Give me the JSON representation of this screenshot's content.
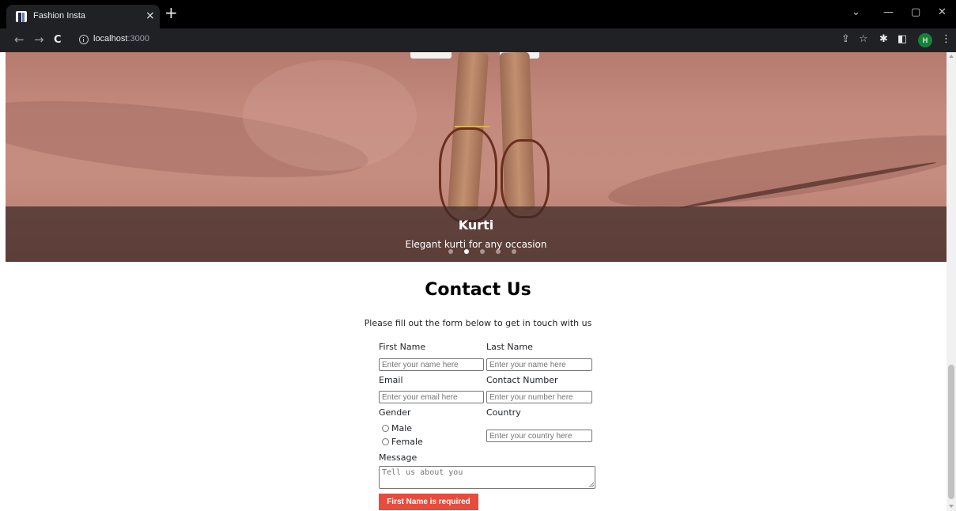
{
  "browser": {
    "tab_title": "Fashion Insta",
    "tab_close": "×",
    "new_tab": "+",
    "url_host": "localhost",
    "url_port": ":3000",
    "profile_initial": "H",
    "icons": {
      "back": "←",
      "forward": "→",
      "reload": "C",
      "share": "⇪",
      "bookmark": "☆",
      "extensions": "✱",
      "sidepanel": "◧",
      "menu": "⋮",
      "tab_search": "⌄",
      "minimize": "—",
      "restore": "▢",
      "close": "✕"
    }
  },
  "carousel": {
    "slide_title": "Kurti",
    "slide_caption": "Elegant kurti for any occasion",
    "indicators_count": 5,
    "active_indicator": 1,
    "background_color": "#c48a7e"
  },
  "contact": {
    "title": "Contact Us",
    "subtitle": "Please fill out the form below to get in touch with us",
    "first_name_label": "First Name",
    "first_name_placeholder": "Enter your name here",
    "last_name_label": "Last Name",
    "last_name_placeholder": "Enter your name here",
    "email_label": "Email",
    "email_placeholder": "Enter your email here",
    "contact_label": "Contact Number",
    "contact_placeholder": "Enter your number here",
    "gender_label": "Gender",
    "gender_options": [
      "Male",
      "Female"
    ],
    "country_label": "Country",
    "country_placeholder": "Enter your country here",
    "message_label": "Message",
    "message_placeholder": "Tell us about you",
    "error_button": "First Name is required",
    "error_color": "#e74c3c"
  }
}
